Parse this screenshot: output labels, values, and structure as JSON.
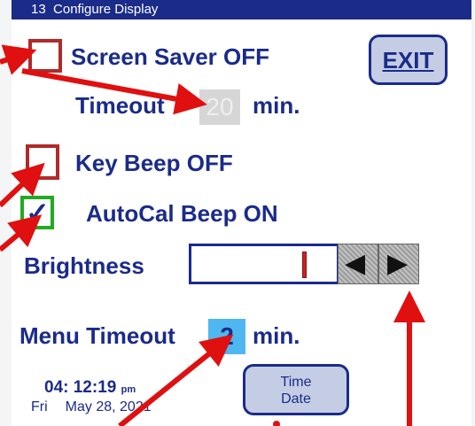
{
  "titlebar": {
    "number": "13",
    "title": "Configure Display"
  },
  "screen_saver": {
    "label": "Screen Saver OFF",
    "checked": false
  },
  "timeout": {
    "label": "Timeout",
    "value": "20",
    "unit": "min."
  },
  "exit_button": {
    "label": "EXIT"
  },
  "key_beep": {
    "label": "Key Beep OFF",
    "checked": false
  },
  "autocal_beep": {
    "label": "AutoCal Beep ON",
    "checked": true,
    "check_glyph": "✓"
  },
  "brightness": {
    "label": "Brightness",
    "level": 0.8,
    "left_arrow": "◀",
    "right_arrow": "▶"
  },
  "menu_timeout": {
    "label": "Menu Timeout",
    "value": "2",
    "unit": "min."
  },
  "clock": {
    "time": "04: 12:19",
    "ampm": "pm",
    "day": "Fri",
    "date": "May 28, 2021"
  },
  "time_date_button": {
    "line1": "Time",
    "line2": "Date"
  },
  "colors": {
    "titlebar": "#1a2b8a",
    "text": "#1a2b8a",
    "checkbox_off": "#b02a2a",
    "checkbox_on": "#22aa22",
    "highlight": "#4fb7ef",
    "annotation_arrow": "#e01010"
  }
}
